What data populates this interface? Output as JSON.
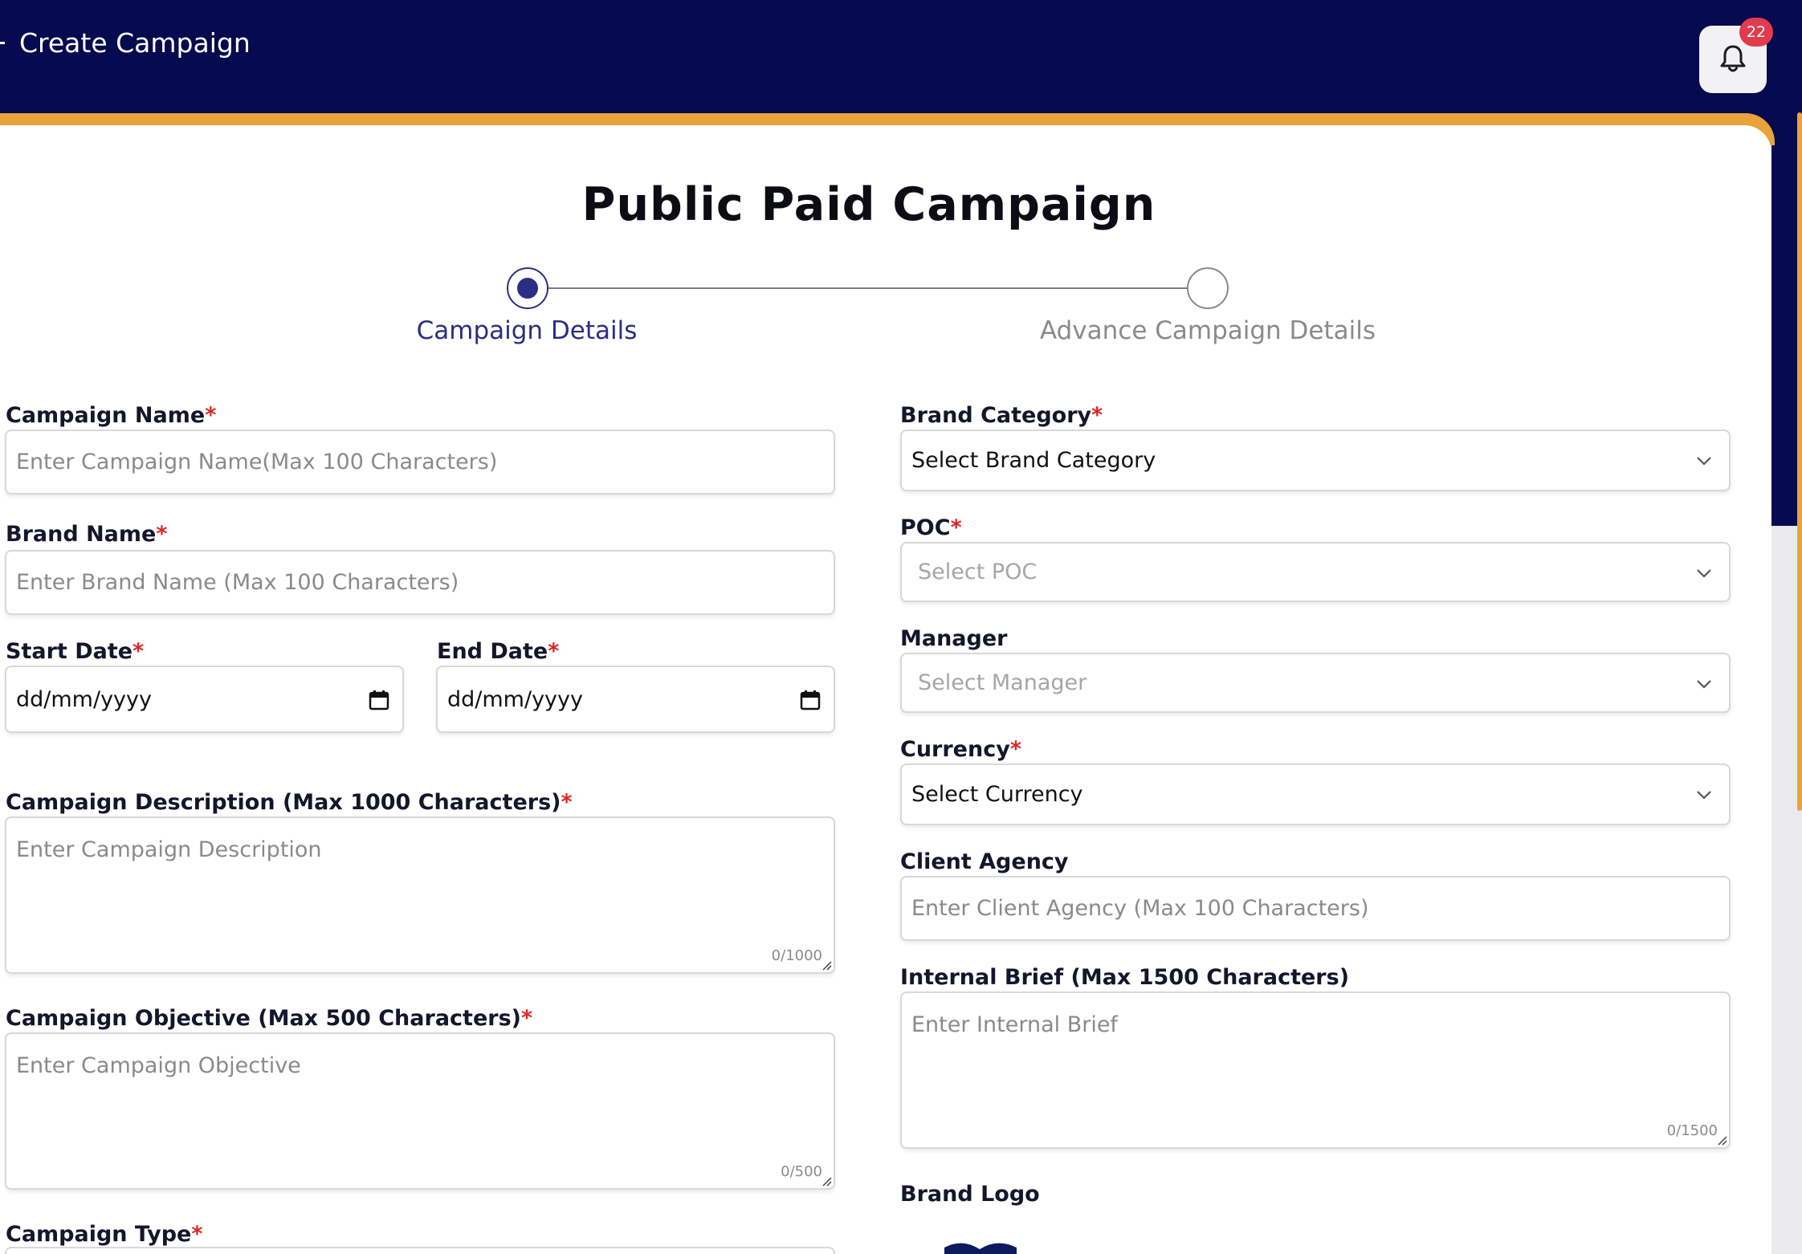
{
  "header": {
    "title": "Create Campaign",
    "notification_count": "22",
    "icons": {
      "notification": "bell-icon"
    }
  },
  "form": {
    "title": "Public Paid Campaign",
    "steps": [
      {
        "label": "Campaign Details",
        "state": "active"
      },
      {
        "label": "Advance Campaign Details",
        "state": "inactive"
      }
    ],
    "required_marker": "*",
    "left": {
      "campaign_name": {
        "label": "Campaign Name",
        "placeholder": "Enter Campaign Name(Max 100 Characters)"
      },
      "brand_name": {
        "label": "Brand Name",
        "placeholder": "Enter Brand Name (Max 100 Characters)"
      },
      "start_date": {
        "label": "Start Date",
        "value": "dd/mm/yyyy"
      },
      "end_date": {
        "label": "End Date",
        "value": "dd/mm/yyyy"
      },
      "campaign_description": {
        "label": "Campaign Description (Max 1000 Characters)",
        "placeholder": "Enter Campaign Description",
        "counter": "0/1000"
      },
      "campaign_objective": {
        "label": "Campaign Objective (Max 500 Characters)",
        "placeholder": "Enter Campaign Objective",
        "counter": "0/500"
      },
      "campaign_type": {
        "label": "Campaign Type"
      }
    },
    "right": {
      "brand_category": {
        "label": "Brand Category",
        "value": "Select Brand Category"
      },
      "poc": {
        "label": "POC",
        "placeholder": "Select POC"
      },
      "manager": {
        "label": "Manager",
        "placeholder": "Select Manager"
      },
      "currency": {
        "label": "Currency",
        "value": "Select Currency"
      },
      "client_agency": {
        "label": "Client Agency",
        "placeholder": "Enter Client Agency (Max 100 Characters)"
      },
      "internal_brief": {
        "label": "Internal Brief (Max 1500 Characters)",
        "placeholder": "Enter Internal Brief",
        "counter": "0/1500"
      },
      "brand_logo": {
        "label": "Brand Logo"
      }
    }
  },
  "colors": {
    "header_bg": "#060a4f",
    "accent_orange": "#e8a33c",
    "step_active": "#2c2d85",
    "required": "#e02424",
    "badge": "#e23b4e"
  }
}
